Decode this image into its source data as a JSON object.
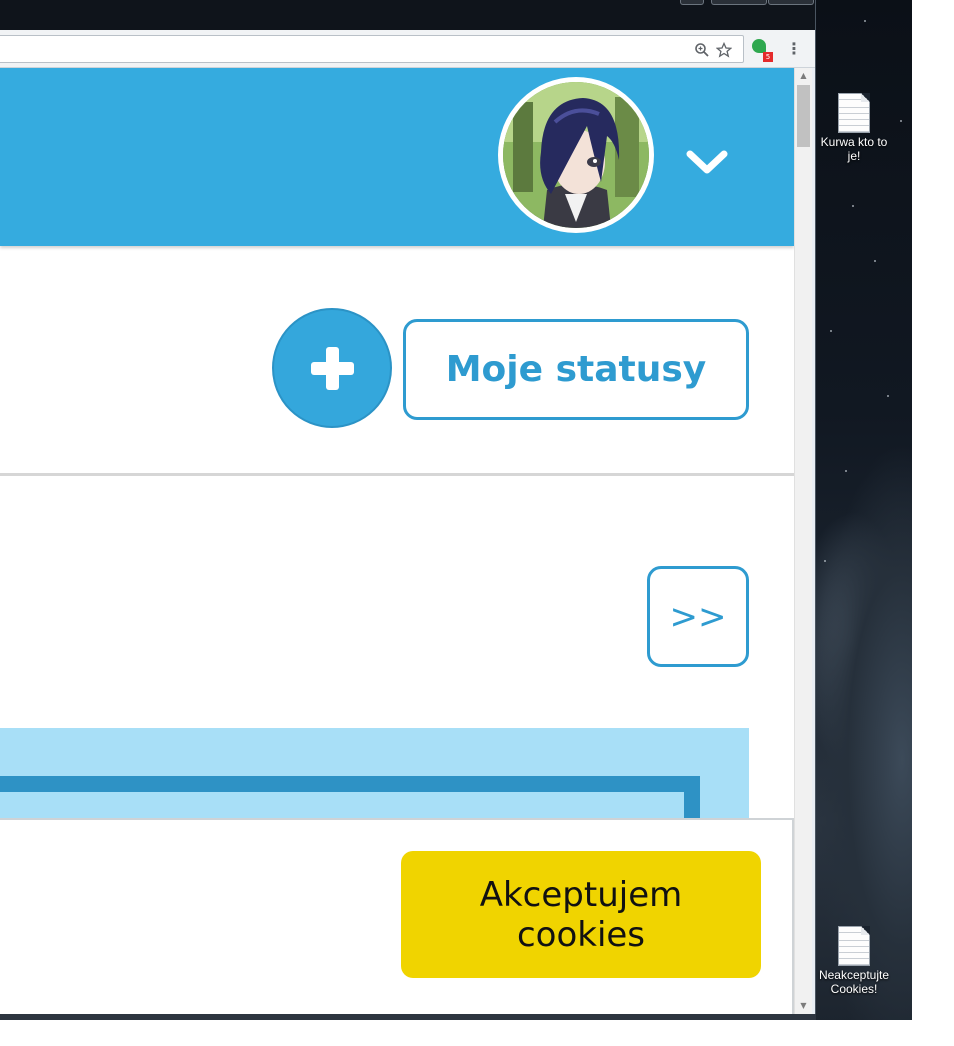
{
  "browser": {
    "omnibox_icons": [
      "zoom-icon",
      "bookmark-star-icon"
    ],
    "extension_badge": "5",
    "extension_badge_color": "#e52b2b"
  },
  "header": {
    "background_color": "#35abdf",
    "avatar_alt": "profile avatar",
    "menu_icon": "chevron-down-icon"
  },
  "actions": {
    "add_icon": "plus-icon",
    "my_statuses_label": "Moje statusy",
    "next_label": ">>",
    "accent_color": "#2e9bd0"
  },
  "cookie_bar": {
    "accept_label": "Akceptujem cookies",
    "button_color": "#f0d400"
  },
  "desktop": {
    "icons": [
      {
        "label": "Kurwa kto to je!"
      },
      {
        "label": "Neakceptujte Cookies!"
      }
    ]
  }
}
